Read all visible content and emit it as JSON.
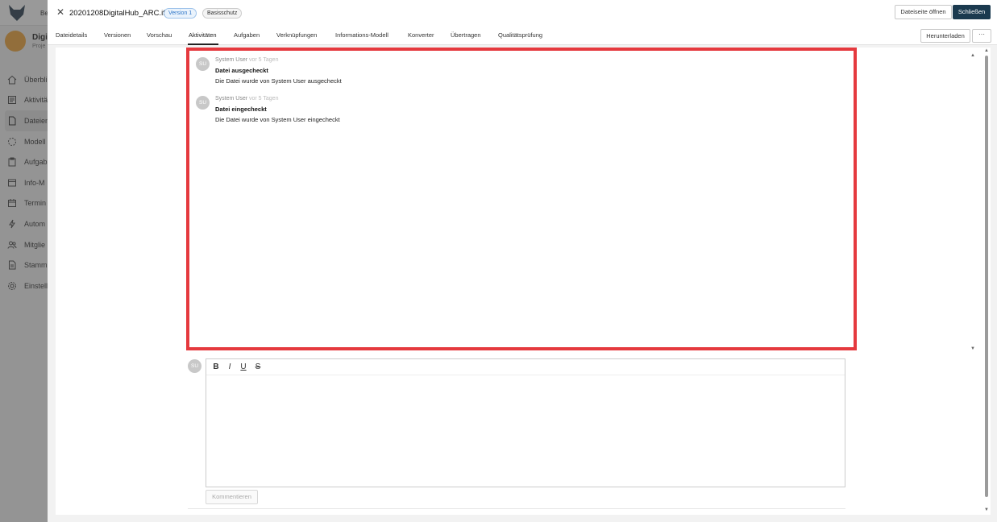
{
  "background_app": {
    "topbar_text": "Be",
    "project": {
      "name": "Digi",
      "sub": "Proje"
    },
    "nav": [
      {
        "label": "Überbli",
        "icon": "home-icon"
      },
      {
        "label": "Aktivitä",
        "icon": "activity-icon"
      },
      {
        "label": "Dateien",
        "icon": "file-icon",
        "active": true
      },
      {
        "label": "Modell",
        "icon": "model-icon"
      },
      {
        "label": "Aufgab",
        "icon": "tasks-icon"
      },
      {
        "label": "Info-M",
        "icon": "info-model-icon"
      },
      {
        "label": "Termin",
        "icon": "calendar-icon"
      },
      {
        "label": "Autom",
        "icon": "lightning-icon"
      },
      {
        "label": "Mitglie",
        "icon": "members-icon"
      },
      {
        "label": "Stamm",
        "icon": "master-data-icon"
      },
      {
        "label": "Einstell",
        "icon": "settings-icon"
      }
    ]
  },
  "header": {
    "file_name": "20201208DigitalHub_ARC.ifc",
    "version_badge": "Version 1",
    "protection_badge": "Basisschutz",
    "open_page_label": "Dateiseite öffnen",
    "close_label": "Schließen"
  },
  "tabs": [
    {
      "label": "Dateidetails"
    },
    {
      "label": "Versionen"
    },
    {
      "label": "Vorschau"
    },
    {
      "label": "Aktivitäten",
      "active": true
    },
    {
      "label": "Aufgaben"
    },
    {
      "label": "Verknüpfungen"
    },
    {
      "label": "Informations-Modell"
    },
    {
      "label": "Konverter"
    },
    {
      "label": "Übertragen"
    },
    {
      "label": "Qualitätsprüfung"
    }
  ],
  "tab_actions": {
    "download_label": "Herunterladen",
    "more_label": "···"
  },
  "activities": [
    {
      "initials": "SU",
      "user": "System User",
      "time": "vor 5 Tagen",
      "title": "Datei ausgecheckt",
      "description": "Die Datei wurde von System User ausgecheckt"
    },
    {
      "initials": "SU",
      "user": "System User",
      "time": "vor 5 Tagen",
      "title": "Datei eingecheckt",
      "description": "Die Datei wurde von System User eingecheckt"
    }
  ],
  "comment": {
    "avatar_initials": "SU",
    "toolbar": {
      "bold": "B",
      "italic": "I",
      "underline": "U",
      "strike": "S"
    },
    "submit_label": "Kommentieren"
  },
  "colors": {
    "highlight_border": "#e5393e",
    "primary_button": "#1b3a4f",
    "version_badge": "#2f76c8"
  }
}
